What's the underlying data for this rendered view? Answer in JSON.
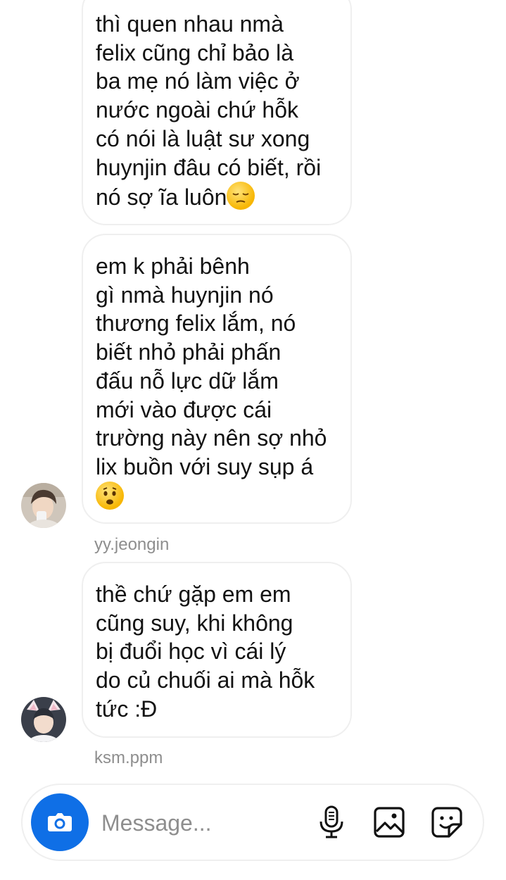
{
  "messages": [
    {
      "lines": [
        "thì quen nhau nmà",
        "felix cũng chỉ bảo là",
        "ba mẹ nó làm việc ở",
        "nước ngoài chứ hỗk",
        "có nói là luật sư xong",
        "huynjin đâu có biết, rồi",
        "nó sợ ĩa luôn"
      ],
      "emoji": "pensive-face"
    },
    {
      "lines": [
        "em k phải bênh",
        "gì nmà huynjin nó",
        "thương felix lắm, nó",
        "biết nhỏ phải phấn",
        "đấu nỗ lực dữ lắm",
        "mới vào được cái",
        "trường này nên sợ nhỏ",
        "lix buồn với suy sụp á"
      ],
      "emoji": "frowning-open-mouth-face"
    },
    {
      "lines": [
        "thề chứ gặp em em",
        "cũng suy, khi không",
        "bị đuổi học vì cái lý",
        "do củ chuối ai mà hỗk",
        "tức :Đ"
      ]
    }
  ],
  "senders": [
    "yy.jeongin",
    "ksm.ppm"
  ],
  "composer": {
    "placeholder": "Message...",
    "icons": [
      "camera-icon",
      "microphone-icon",
      "gallery-icon",
      "sticker-icon"
    ],
    "accent": "#0f6fe6"
  }
}
